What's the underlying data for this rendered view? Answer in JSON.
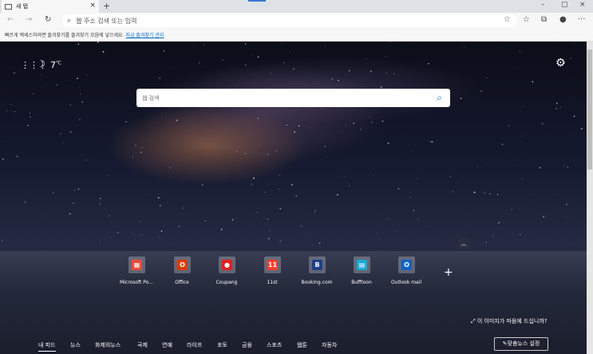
{
  "tab": {
    "title": "새 탭",
    "close": "×",
    "new": "+"
  },
  "window": {
    "minimize": "–",
    "maximize": "▢",
    "close": "×"
  },
  "toolbar": {
    "back": "←",
    "forward": "→",
    "refresh": "↻",
    "address_placeholder": "웹 주소 검색 또는 입력",
    "more": "···"
  },
  "favbar": {
    "text": "빠르게 액세스하려면 즐겨찾기를 즐겨찾기 모음에 넣으세요.",
    "link": "지금 즐겨찾기 관리"
  },
  "weather": {
    "temp": "7",
    "unit": "℃",
    "icon": "moon-icon"
  },
  "search": {
    "placeholder": "웹 검색"
  },
  "tiles": [
    {
      "label": "Microsoft Po...",
      "color": "#e74c3c",
      "glyph": "▦"
    },
    {
      "label": "Office",
      "color": "#d83b01",
      "glyph": "O"
    },
    {
      "label": "Coupang",
      "color": "#e02020",
      "glyph": "●"
    },
    {
      "label": "11st",
      "color": "#ff3b30",
      "glyph": "11"
    },
    {
      "label": "Booking.com",
      "color": "#1c3f8a",
      "glyph": "B"
    },
    {
      "label": "Bufftoon",
      "color": "#19a9d6",
      "glyph": "▤"
    },
    {
      "label": "Outlook mail",
      "color": "#0f62c4",
      "glyph": "O"
    }
  ],
  "add_tile": "+",
  "like_image": "이 이미지가 마음에 드십니까?",
  "feed_tabs": [
    "내 피드",
    "뉴스",
    "화제의뉴스",
    "국제",
    "연예",
    "라이프",
    "포토",
    "금융",
    "스포츠",
    "웹툰",
    "자동차"
  ],
  "personalize": "맞춤뉴스 설정"
}
